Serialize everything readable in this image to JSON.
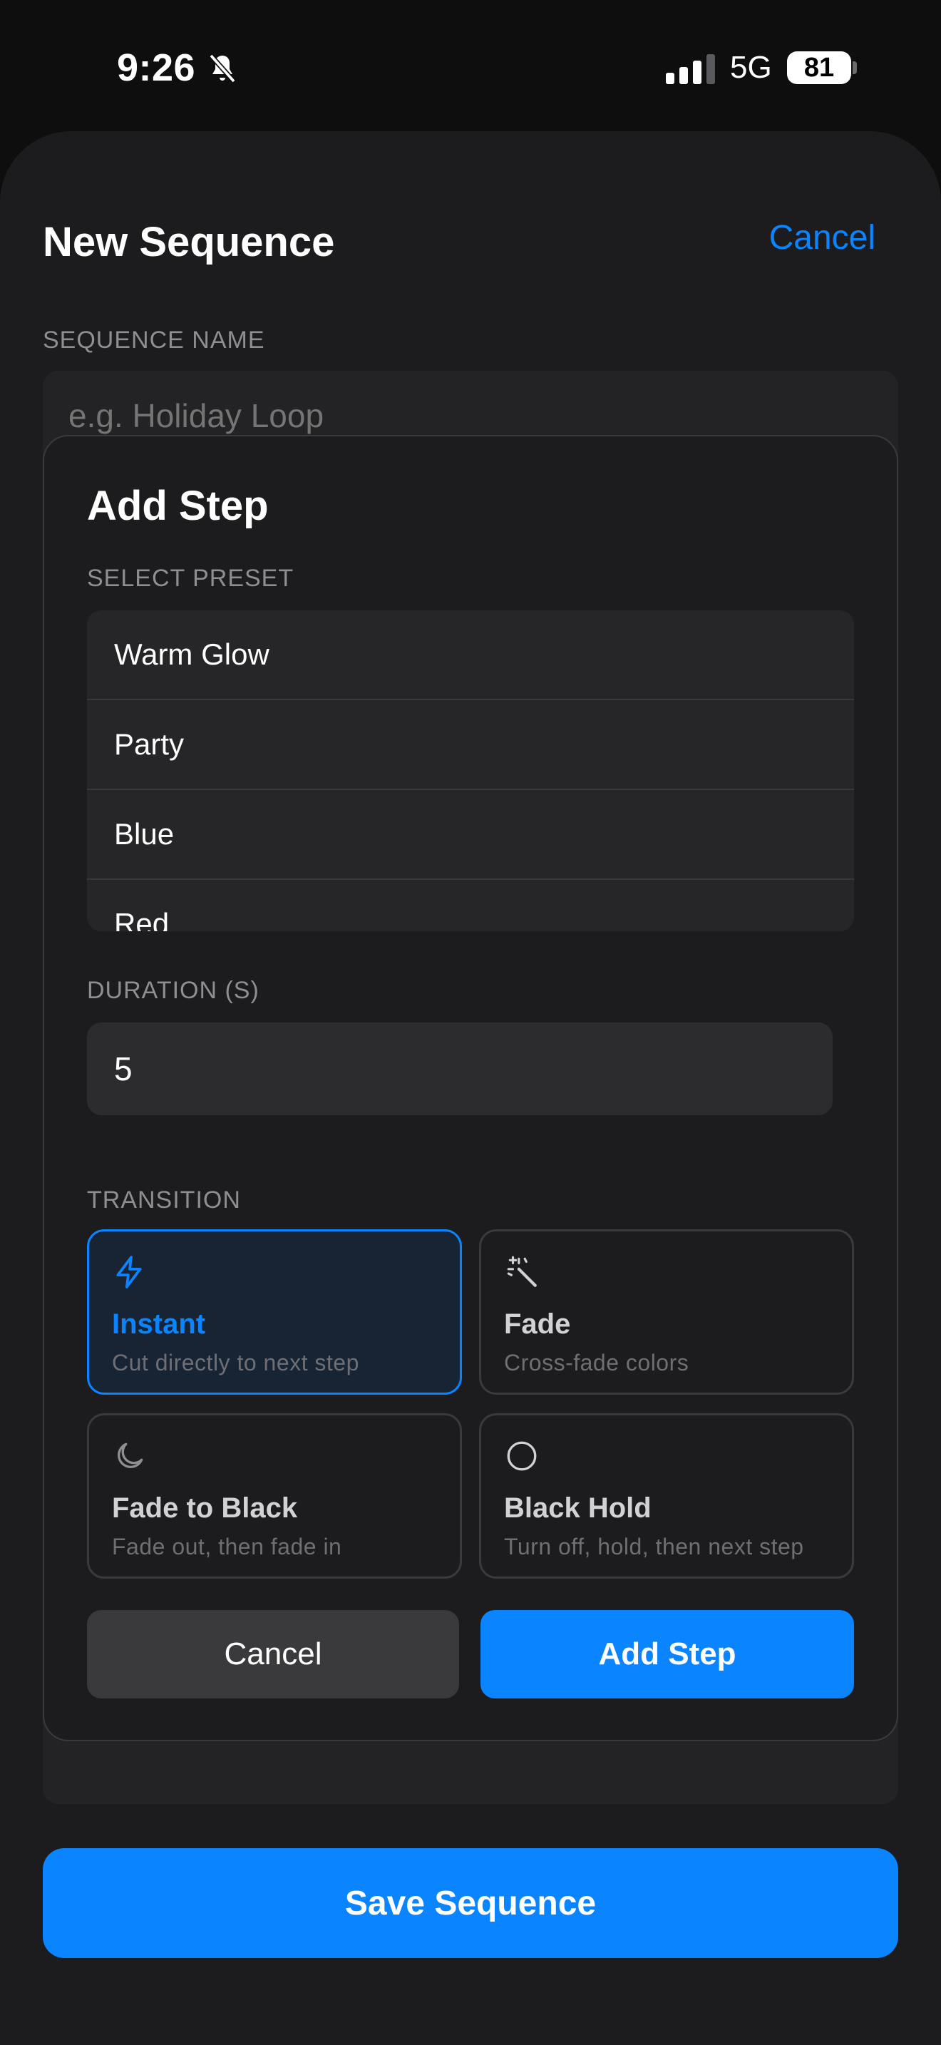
{
  "status_bar": {
    "time": "9:26",
    "network": "5G",
    "battery": "81"
  },
  "sheet": {
    "title": "New Sequence",
    "cancel_label": "Cancel",
    "name_label": "SEQUENCE NAME",
    "name_placeholder": "e.g. Holiday Loop",
    "save_label": "Save Sequence"
  },
  "modal": {
    "title": "Add Step",
    "preset_label": "SELECT PRESET",
    "presets": [
      "Warm Glow",
      "Party",
      "Blue",
      "Red"
    ],
    "duration_label": "DURATION (S)",
    "duration_value": "5",
    "transition_label": "TRANSITION",
    "transitions": [
      {
        "title": "Instant",
        "desc": "Cut directly to next step",
        "icon": "bolt-icon",
        "selected": true
      },
      {
        "title": "Fade",
        "desc": "Cross-fade colors",
        "icon": "magic-wand-icon",
        "selected": false
      },
      {
        "title": "Fade to Black",
        "desc": "Fade out, then fade in",
        "icon": "moon-icon",
        "selected": false
      },
      {
        "title": "Black Hold",
        "desc": "Turn off, hold, then next step",
        "icon": "circle-icon",
        "selected": false
      }
    ],
    "cancel_label": "Cancel",
    "add_label": "Add Step"
  },
  "colors": {
    "accent": "#0a84ff",
    "background": "#1c1c1e",
    "selected_card": "#172434"
  }
}
